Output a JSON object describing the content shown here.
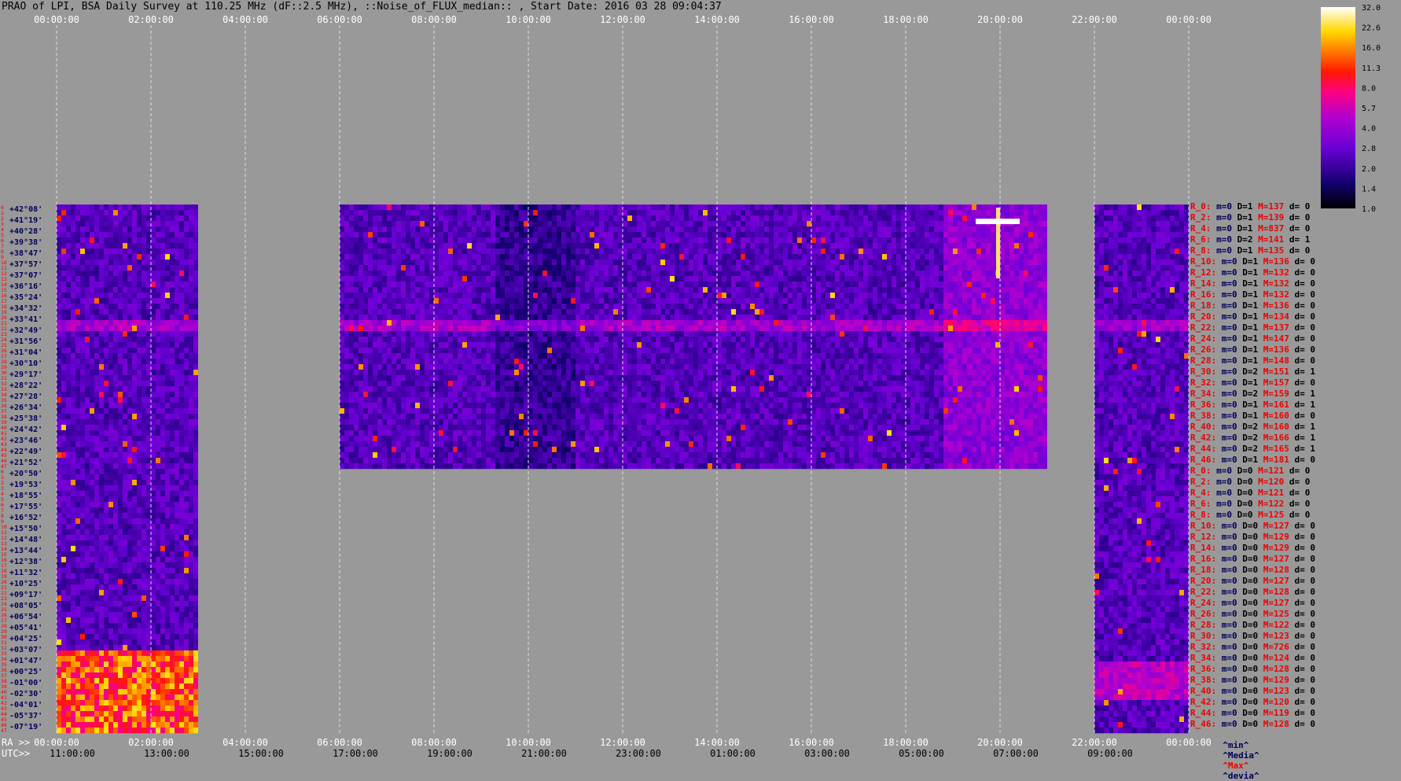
{
  "title": "PRAO of LPI, BSA Daily Survey at 110.25 MHz (dF::2.5 MHz), ::Noise_of_FLUX_median:: , Start Date: 2016 03 28 09:04:37",
  "chart_data": {
    "type": "heatmap",
    "colormap": "gnuplot/afmhot-like: black-blue-purple-magenta-red-orange-yellow-white",
    "top_axis_ticks": [
      "00:00:00",
      "02:00:00",
      "04:00:00",
      "06:00:00",
      "08:00:00",
      "10:00:00",
      "12:00:00",
      "14:00:00",
      "16:00:00",
      "18:00:00",
      "20:00:00",
      "22:00:00",
      "00:00:00"
    ],
    "bottom_ra_prefix": "RA >>",
    "bottom_ra_ticks": [
      "00:00:00",
      "02:00:00",
      "04:00:00",
      "06:00:00",
      "08:00:00",
      "10:00:00",
      "12:00:00",
      "14:00:00",
      "16:00:00",
      "18:00:00",
      "20:00:00",
      "22:00:00",
      "00:00:00"
    ],
    "bottom_utc_prefix": "UTC>>",
    "bottom_utc_ticks": [
      "11:00:00",
      "13:00:00",
      "15:00:00",
      "17:00:00",
      "19:00:00",
      "21:00:00",
      "23:00:00",
      "01:00:00",
      "03:00:00",
      "05:00:00",
      "07:00:00",
      "09:00:00"
    ],
    "colorbar_ticks": [
      "32.0",
      "22.6",
      "16.0",
      "11.3",
      "8.0",
      "5.7",
      "4.0",
      "2.8",
      "2.0",
      "1.4",
      "1.0"
    ],
    "colorbar_range": [
      1.0,
      32.0
    ],
    "colorbar_scale": "log",
    "row_numbers": [
      "0",
      "1",
      "2",
      "3",
      "4",
      "5",
      "6",
      "7",
      "8",
      "9",
      "10",
      "11",
      "12",
      "13",
      "14",
      "15",
      "16",
      "17",
      "18",
      "19",
      "20",
      "21",
      "22",
      "23",
      "24",
      "25",
      "26",
      "27",
      "28",
      "29",
      "30",
      "31",
      "32",
      "33",
      "34",
      "35",
      "36",
      "37",
      "38",
      "39",
      "40",
      "41",
      "42",
      "43",
      "44",
      "45",
      "46",
      "47",
      "0",
      "1",
      "2",
      "3",
      "4",
      "5",
      "6",
      "7",
      "8",
      "9",
      "10",
      "11",
      "12",
      "13",
      "14",
      "15",
      "16",
      "17",
      "18",
      "19",
      "20",
      "21",
      "22",
      "23",
      "24",
      "25",
      "26",
      "27",
      "28",
      "29",
      "30",
      "31",
      "32",
      "33",
      "34",
      "35",
      "36",
      "37",
      "38",
      "39",
      "40",
      "41",
      "42",
      "43",
      "44",
      "45",
      "46",
      "47"
    ],
    "declinations": [
      "+42°08'",
      "+41°19'",
      "+40°28'",
      "+39°38'",
      "+38°47'",
      "+37°57'",
      "+37°07'",
      "+36°16'",
      "+35°24'",
      "+34°32'",
      "+33°41'",
      "+32°49'",
      "+31°56'",
      "+31°04'",
      "+30°10'",
      "+29°17'",
      "+28°22'",
      "+27°28'",
      "+26°34'",
      "+25°38'",
      "+24°42'",
      "+23°46'",
      "+22°49'",
      "+21°52'",
      "+20°50'",
      "+19°53'",
      "+18°55'",
      "+17°55'",
      "+16°52'",
      "+15°50'",
      "+14°48'",
      "+13°44'",
      "+12°38'",
      "+11°32'",
      "+10°25'",
      "+09°17'",
      "+08°05'",
      "+06°54'",
      "+05°41'",
      "+04°25'",
      "+03°07'",
      "+01°47'",
      "+00°25'",
      "-01°00'",
      "-02°30'",
      "-04°01'",
      "-05°37'",
      "-07°19'"
    ],
    "data_blocks": [
      {
        "ra_start_h": 0.0,
        "ra_end_h": 2.95,
        "rows": "all"
      },
      {
        "ra_start_h": 6.0,
        "ra_end_h": 20.95,
        "rows": "top-half"
      },
      {
        "ra_start_h": 22.0,
        "ra_end_h": 24.0,
        "rows": "all"
      }
    ],
    "right_legend": [
      {
        "r": "R_0:",
        "m": "m=0",
        "d": "D=1",
        "M": "M=137",
        "dv": "d= 0"
      },
      {
        "r": "R_2:",
        "m": "m=0",
        "d": "D=1",
        "M": "M=139",
        "dv": "d= 0"
      },
      {
        "r": "R_4:",
        "m": "m=0",
        "d": "D=1",
        "M": "M=837",
        "dv": "d= 0"
      },
      {
        "r": "R_6:",
        "m": "m=0",
        "d": "D=2",
        "M": "M=141",
        "dv": "d= 1"
      },
      {
        "r": "R_8:",
        "m": "m=0",
        "d": "D=1",
        "M": "M=135",
        "dv": "d= 0"
      },
      {
        "r": "R_10:",
        "m": "m=0",
        "d": "D=1",
        "M": "M=136",
        "dv": "d= 0"
      },
      {
        "r": "R_12:",
        "m": "m=0",
        "d": "D=1",
        "M": "M=132",
        "dv": "d= 0"
      },
      {
        "r": "R_14:",
        "m": "m=0",
        "d": "D=1",
        "M": "M=132",
        "dv": "d= 0"
      },
      {
        "r": "R_16:",
        "m": "m=0",
        "d": "D=1",
        "M": "M=132",
        "dv": "d= 0"
      },
      {
        "r": "R_18:",
        "m": "m=0",
        "d": "D=1",
        "M": "M=136",
        "dv": "d= 0"
      },
      {
        "r": "R_20:",
        "m": "m=0",
        "d": "D=1",
        "M": "M=134",
        "dv": "d= 0"
      },
      {
        "r": "R_22:",
        "m": "m=0",
        "d": "D=1",
        "M": "M=137",
        "dv": "d= 0"
      },
      {
        "r": "R_24:",
        "m": "m=0",
        "d": "D=1",
        "M": "M=147",
        "dv": "d= 0"
      },
      {
        "r": "R_26:",
        "m": "m=0",
        "d": "D=1",
        "M": "M=136",
        "dv": "d= 0"
      },
      {
        "r": "R_28:",
        "m": "m=0",
        "d": "D=1",
        "M": "M=148",
        "dv": "d= 0"
      },
      {
        "r": "R_30:",
        "m": "m=0",
        "d": "D=2",
        "M": "M=151",
        "dv": "d= 1"
      },
      {
        "r": "R_32:",
        "m": "m=0",
        "d": "D=1",
        "M": "M=157",
        "dv": "d= 0"
      },
      {
        "r": "R_34:",
        "m": "m=0",
        "d": "D=2",
        "M": "M=159",
        "dv": "d= 1"
      },
      {
        "r": "R_36:",
        "m": "m=0",
        "d": "D=1",
        "M": "M=161",
        "dv": "d= 1"
      },
      {
        "r": "R_38:",
        "m": "m=0",
        "d": "D=1",
        "M": "M=160",
        "dv": "d= 0"
      },
      {
        "r": "R_40:",
        "m": "m=0",
        "d": "D=2",
        "M": "M=160",
        "dv": "d= 1"
      },
      {
        "r": "R_42:",
        "m": "m=0",
        "d": "D=2",
        "M": "M=166",
        "dv": "d= 1"
      },
      {
        "r": "R_44:",
        "m": "m=0",
        "d": "D=2",
        "M": "M=165",
        "dv": "d= 1"
      },
      {
        "r": "R_46:",
        "m": "m=0",
        "d": "D=1",
        "M": "M=181",
        "dv": "d= 0"
      },
      {
        "r": "R_0:",
        "m": "m=0",
        "d": "D=0",
        "M": "M=121",
        "dv": "d= 0"
      },
      {
        "r": "R_2:",
        "m": "m=0",
        "d": "D=0",
        "M": "M=120",
        "dv": "d= 0"
      },
      {
        "r": "R_4:",
        "m": "m=0",
        "d": "D=0",
        "M": "M=121",
        "dv": "d= 0"
      },
      {
        "r": "R_6:",
        "m": "m=0",
        "d": "D=0",
        "M": "M=122",
        "dv": "d= 0"
      },
      {
        "r": "R_8:",
        "m": "m=0",
        "d": "D=0",
        "M": "M=125",
        "dv": "d= 0"
      },
      {
        "r": "R_10:",
        "m": "m=0",
        "d": "D=0",
        "M": "M=127",
        "dv": "d= 0"
      },
      {
        "r": "R_12:",
        "m": "m=0",
        "d": "D=0",
        "M": "M=129",
        "dv": "d= 0"
      },
      {
        "r": "R_14:",
        "m": "m=0",
        "d": "D=0",
        "M": "M=129",
        "dv": "d= 0"
      },
      {
        "r": "R_16:",
        "m": "m=0",
        "d": "D=0",
        "M": "M=127",
        "dv": "d= 0"
      },
      {
        "r": "R_18:",
        "m": "m=0",
        "d": "D=0",
        "M": "M=128",
        "dv": "d= 0"
      },
      {
        "r": "R_20:",
        "m": "m=0",
        "d": "D=0",
        "M": "M=127",
        "dv": "d= 0"
      },
      {
        "r": "R_22:",
        "m": "m=0",
        "d": "D=0",
        "M": "M=128",
        "dv": "d= 0"
      },
      {
        "r": "R_24:",
        "m": "m=0",
        "d": "D=0",
        "M": "M=127",
        "dv": "d= 0"
      },
      {
        "r": "R_26:",
        "m": "m=0",
        "d": "D=0",
        "M": "M=125",
        "dv": "d= 0"
      },
      {
        "r": "R_28:",
        "m": "m=0",
        "d": "D=0",
        "M": "M=122",
        "dv": "d= 0"
      },
      {
        "r": "R_30:",
        "m": "m=0",
        "d": "D=0",
        "M": "M=123",
        "dv": "d= 0"
      },
      {
        "r": "R_32:",
        "m": "m=0",
        "d": "D=0",
        "M": "M=726",
        "dv": "d= 0"
      },
      {
        "r": "R_34:",
        "m": "m=0",
        "d": "D=0",
        "M": "M=124",
        "dv": "d= 0"
      },
      {
        "r": "R_36:",
        "m": "m=0",
        "d": "D=0",
        "M": "M=128",
        "dv": "d= 0"
      },
      {
        "r": "R_38:",
        "m": "m=0",
        "d": "D=0",
        "M": "M=129",
        "dv": "d= 0"
      },
      {
        "r": "R_40:",
        "m": "m=0",
        "d": "D=0",
        "M": "M=123",
        "dv": "d= 0"
      },
      {
        "r": "R_42:",
        "m": "m=0",
        "d": "D=0",
        "M": "M=120",
        "dv": "d= 0"
      },
      {
        "r": "R_44:",
        "m": "m=0",
        "d": "D=0",
        "M": "M=119",
        "dv": "d= 0"
      },
      {
        "r": "R_46:",
        "m": "m=0",
        "d": "D=0",
        "M": "M=128",
        "dv": "d= 0"
      }
    ],
    "legend_footer": {
      "min": "^min^",
      "media": "^Media^",
      "max": "^Max^",
      "devia": "^devia^"
    }
  },
  "colors": {
    "background": "#999999",
    "label_red": "#ee0000",
    "label_navy": "#00005a",
    "grid": "#dddddd"
  }
}
